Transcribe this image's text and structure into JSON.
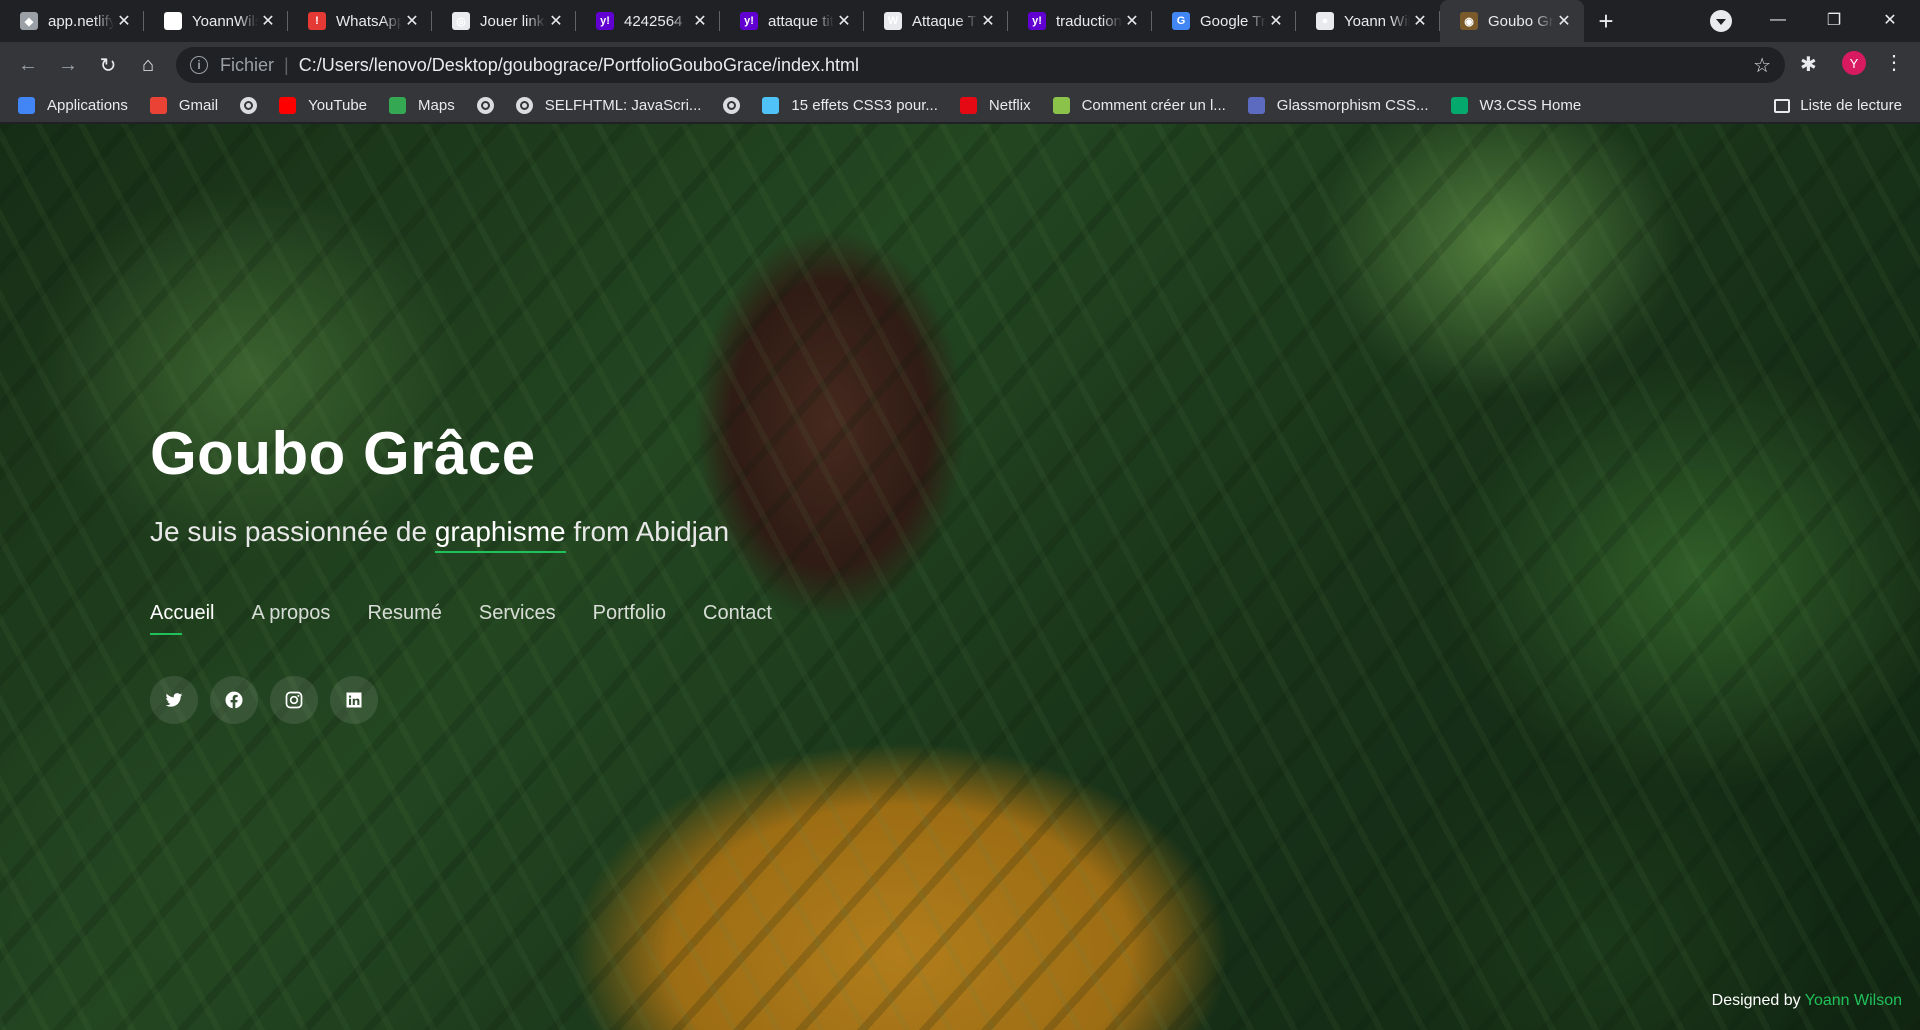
{
  "browser": {
    "tabs": [
      {
        "title": "app.netlify.com",
        "favicon": "netlify-diamond",
        "favicon_color": "#9aa0a6",
        "glyph": "◆"
      },
      {
        "title": "YoannWilson",
        "favicon": "github-icon",
        "favicon_color": "#ffffff",
        "glyph": "●"
      },
      {
        "title": "WhatsApp",
        "favicon": "alert-icon",
        "favicon_color": "#e53935",
        "glyph": "!"
      },
      {
        "title": "Jouer linkedin",
        "favicon": "globe-outline-icon",
        "favicon_color": "#e8eaed",
        "glyph": "◎"
      },
      {
        "title": "4242564",
        "favicon": "yahoo-icon",
        "favicon_color": "#6001d2",
        "glyph": "y!"
      },
      {
        "title": "attaque titan",
        "favicon": "yahoo-icon",
        "favicon_color": "#6001d2",
        "glyph": "y!"
      },
      {
        "title": "Attaque Titan",
        "favicon": "wordpress-icon",
        "favicon_color": "#e8eaed",
        "glyph": "W"
      },
      {
        "title": "traduction",
        "favicon": "yahoo-icon",
        "favicon_color": "#6001d2",
        "glyph": "y!"
      },
      {
        "title": "Google Traduction",
        "favicon": "google-translate-icon",
        "favicon_color": "#4285f4",
        "glyph": "G"
      },
      {
        "title": "Yoann Wilson",
        "favicon": "globe-icon",
        "favicon_color": "#e8eaed",
        "glyph": "●"
      },
      {
        "title": "Goubo Grâce",
        "favicon": "portrait-icon",
        "favicon_color": "#7a5a2a",
        "glyph": "◉",
        "active": true
      }
    ],
    "address": {
      "scheme": "Fichier",
      "url": "C:/Users/lenovo/Desktop/goubograce/PortfolioGouboGrace/index.html"
    },
    "profile_initial": "Y",
    "bookmarks": [
      {
        "label": "Applications",
        "icon": "apps-grid-icon",
        "color": "#4285f4"
      },
      {
        "label": "Gmail",
        "icon": "gmail-icon",
        "color": "#ea4335"
      },
      {
        "label": "",
        "icon": "globe-icon",
        "color": "#dadce0"
      },
      {
        "label": "YouTube",
        "icon": "youtube-icon",
        "color": "#ff0000"
      },
      {
        "label": "Maps",
        "icon": "maps-icon",
        "color": "#34a853"
      },
      {
        "label": "",
        "icon": "globe-icon",
        "color": "#dadce0"
      },
      {
        "label": "SELFHTML: JavaScri...",
        "icon": "globe-icon",
        "color": "#dadce0"
      },
      {
        "label": "",
        "icon": "globe-icon",
        "color": "#dadce0"
      },
      {
        "label": "15 effets CSS3 pour...",
        "icon": "css-icon",
        "color": "#4fc3f7"
      },
      {
        "label": "Netflix",
        "icon": "netflix-icon",
        "color": "#e50914"
      },
      {
        "label": "Comment créer un l...",
        "icon": "android-icon",
        "color": "#8bc34a"
      },
      {
        "label": "Glassmorphism CSS...",
        "icon": "glass-icon",
        "color": "#5c6bc0"
      },
      {
        "label": "W3.CSS Home",
        "icon": "w3-icon",
        "color": "#04aa6d"
      }
    ],
    "reading_list": "Liste de lecture"
  },
  "page": {
    "name": "Goubo Grâce",
    "tagline_prefix": "Je suis passionnée de",
    "tagline_typed": "graphisme",
    "tagline_suffix": "from Abidjan",
    "nav": [
      {
        "label": "Accueil",
        "active": true
      },
      {
        "label": "A propos"
      },
      {
        "label": "Resumé"
      },
      {
        "label": "Services"
      },
      {
        "label": "Portfolio"
      },
      {
        "label": "Contact"
      }
    ],
    "social": [
      "twitter-icon",
      "facebook-icon",
      "instagram-icon",
      "linkedin-icon"
    ],
    "credits_prefix": "Designed by",
    "credits_author": "Yoann Wilson",
    "accent": "#20c05a"
  }
}
